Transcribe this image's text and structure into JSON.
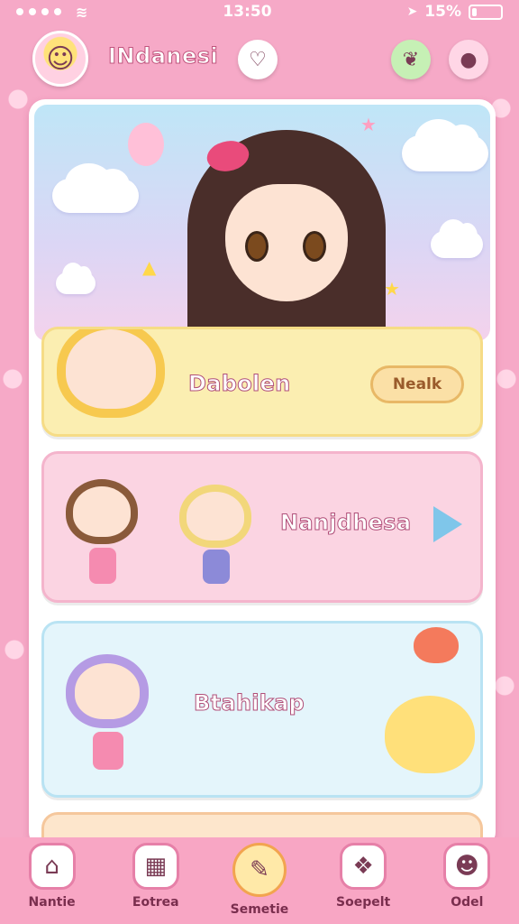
{
  "status": {
    "time": "13:50",
    "battery": "15%",
    "battery_level": 0.15
  },
  "header": {
    "title": "INdanesi",
    "avatar_icon": "avatar",
    "center_icon": "heart-shield-icon",
    "right_icons": [
      "leaf-icon",
      "balloon-icon"
    ]
  },
  "cards": [
    {
      "label": "Dabolen",
      "action": "Nealk"
    },
    {
      "label": "Nanjdhesa"
    },
    {
      "label": "Btahikap"
    }
  ],
  "tabs": [
    {
      "label": "Nantie",
      "icon": "home-icon"
    },
    {
      "label": "Eotrea",
      "icon": "map-icon"
    },
    {
      "label": "Semetie",
      "icon": "chat-icon"
    },
    {
      "label": "Soepelt",
      "icon": "gift-icon"
    },
    {
      "label": "Odel",
      "icon": "profile-icon"
    }
  ],
  "colors": {
    "accent": "#f6a9c7",
    "card1": "#fbeeb1",
    "card2": "#fbd4e2",
    "card3": "#e4f5fb"
  }
}
